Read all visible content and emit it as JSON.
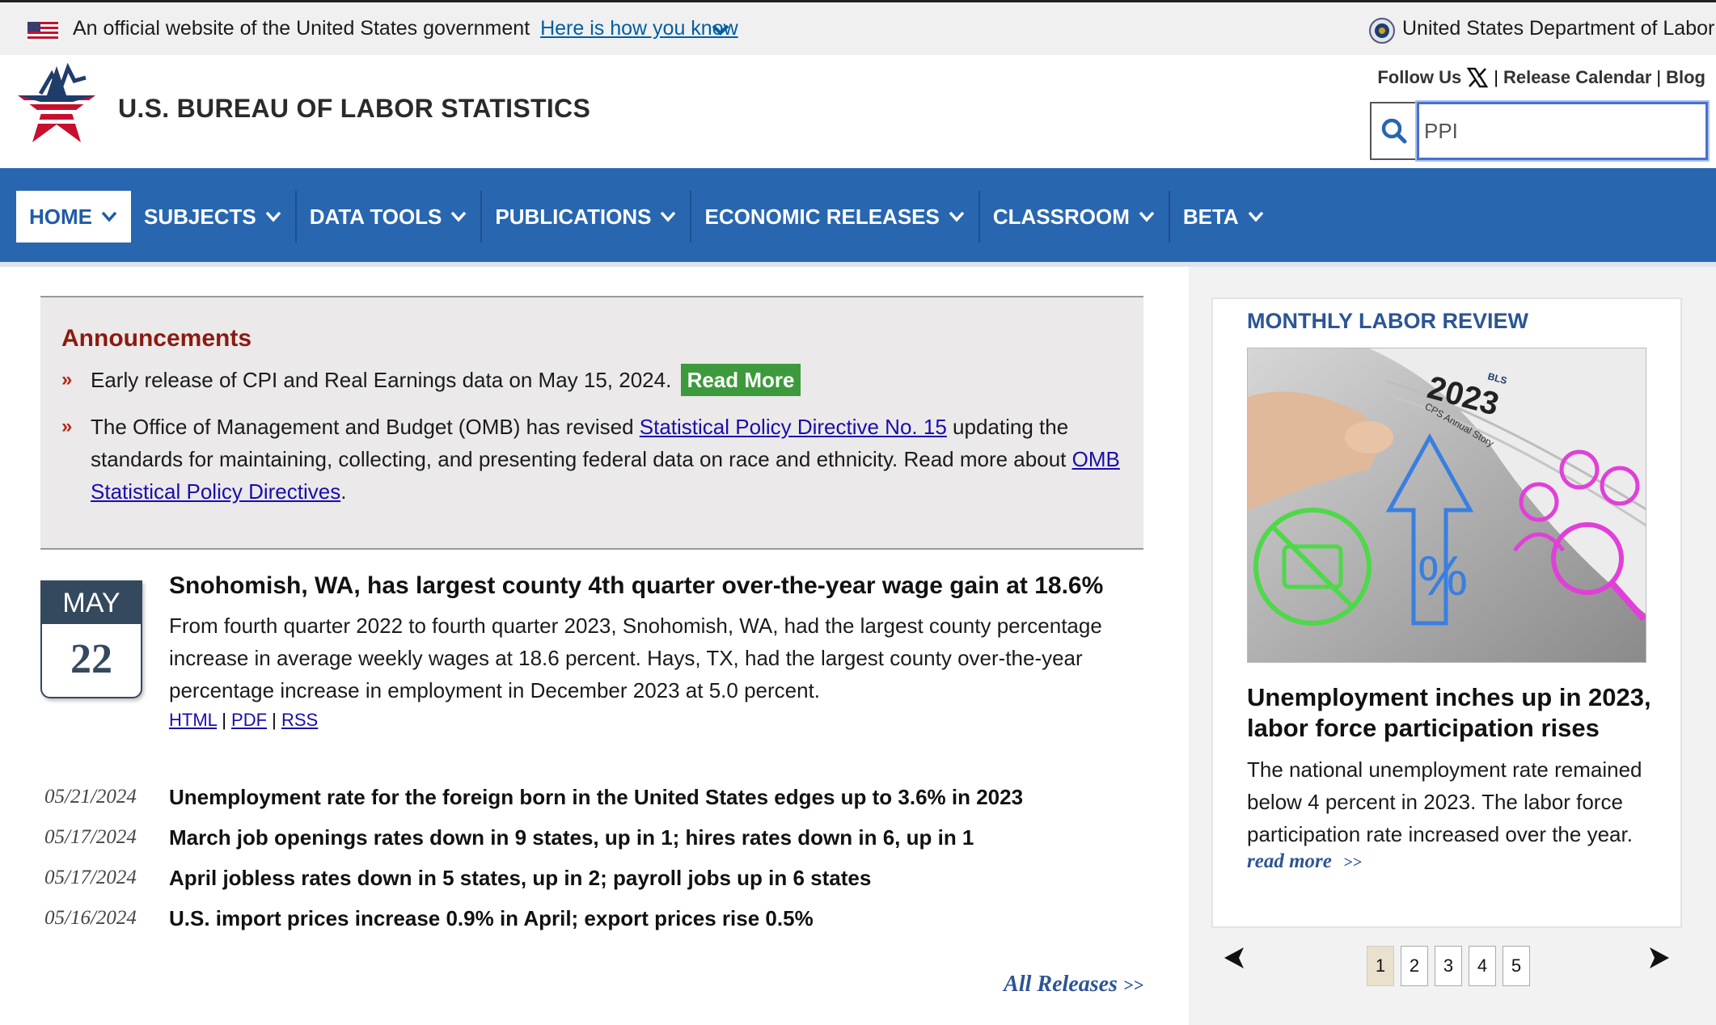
{
  "gov_banner": {
    "text": "An official website of the United States government",
    "link": "Here is how you know",
    "agency": "United States Department of Labor"
  },
  "header": {
    "site_title": "U.S. BUREAU OF LABOR STATISTICS",
    "follow_us": "Follow Us",
    "release_calendar": "Release Calendar",
    "blog": "Blog",
    "separator": "|",
    "search_value": "PPI"
  },
  "nav": {
    "items": [
      "HOME",
      "SUBJECTS",
      "DATA TOOLS",
      "PUBLICATIONS",
      "ECONOMIC RELEASES",
      "CLASSROOM",
      "BETA"
    ]
  },
  "announcements": {
    "title": "Announcements",
    "bullet": "»",
    "item1_text": "Early release of CPI and Real Earnings data on May 15, 2024.",
    "item1_button": "Read More",
    "item2_pre": "The Office of Management and Budget (OMB) has revised",
    "item2_link": "Statistical Policy Directive No. 15",
    "item2_mid": "updating the standards for maintaining, collecting, and presenting federal data on race and ethnicity. Read more about",
    "item2_link2": "OMB Statistical Policy Directives",
    "item2_end": "."
  },
  "feature": {
    "month": "MAY",
    "day": "22",
    "title": "Snohomish, WA, has largest county 4th quarter over-the-year wage gain at 18.6%",
    "description": "From fourth quarter 2022 to fourth quarter 2023, Snohomish, WA, had the largest county percentage increase in average weekly wages at 18.6 percent. Hays, TX, had the largest county over-the-year percentage increase in employment in December 2023 at 5.0 percent.",
    "links": [
      "HTML",
      "PDF",
      "RSS"
    ]
  },
  "releases": [
    {
      "date": "05/21/2024",
      "title": "Unemployment rate for the foreign born in the United States edges up to 3.6% in 2023"
    },
    {
      "date": "05/17/2024",
      "title": "March job openings rates down in 9 states, up in 1; hires rates down in 6, up in 1"
    },
    {
      "date": "05/17/2024",
      "title": "April jobless rates down in 5 states, up in 2; payroll jobs up in 6 states"
    },
    {
      "date": "05/16/2024",
      "title": "U.S. import prices increase 0.9% in April; export prices rise 0.5%"
    }
  ],
  "all_releases": "All Releases",
  "all_releases_arrow": ">>",
  "sidebar": {
    "title": "MONTHLY LABOR REVIEW",
    "image_year": "2023",
    "image_caption": "CPS Annual Story",
    "image_brand": "BLS",
    "headline": "Unemployment inches up in 2023, labor force participation rises",
    "description": "The national unemployment rate remained below 4 percent in 2023. The labor force participation rate increased over the year.",
    "read_more": "read more",
    "read_more_arrow": ">>",
    "pages": [
      "1",
      "2",
      "3",
      "4",
      "5"
    ],
    "current_page": "1"
  },
  "colors": {
    "nav_blue": "#2866b0",
    "announce_red": "#8b1a10",
    "link_blue": "#1a0dab",
    "mlr_blue": "#2c5594",
    "read_more_green": "#3c9a3c"
  }
}
